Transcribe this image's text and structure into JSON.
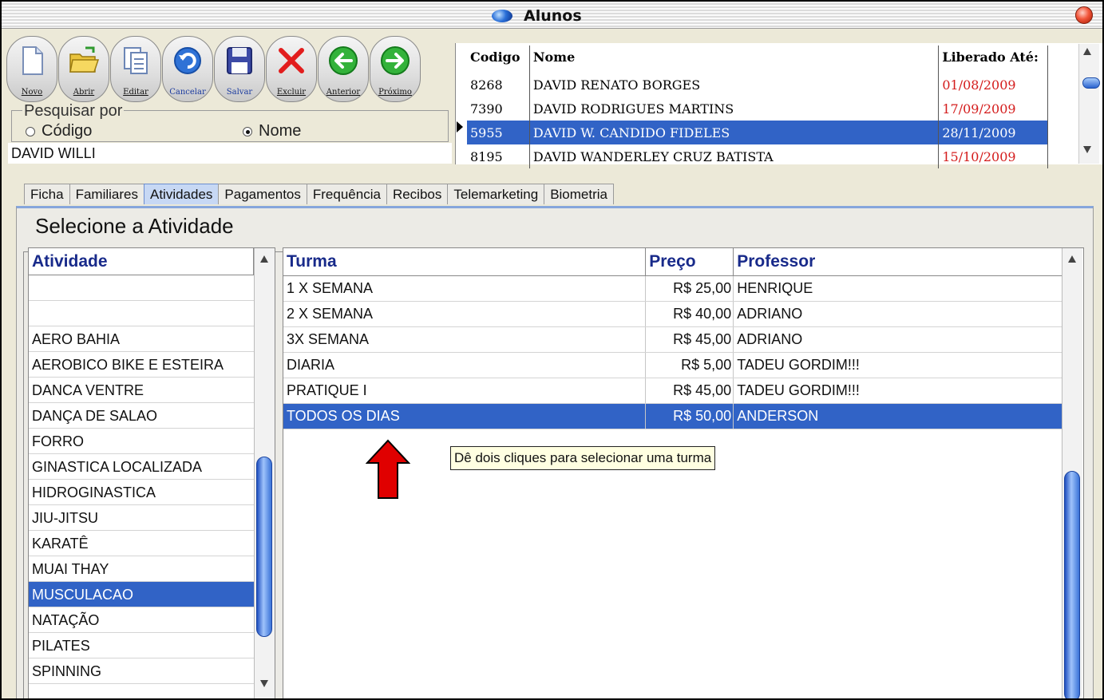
{
  "window": {
    "title": "Alunos"
  },
  "toolbar": {
    "buttons": [
      {
        "label": "Novo",
        "icon": "new-document-icon"
      },
      {
        "label": "Abrir",
        "icon": "open-folder-icon"
      },
      {
        "label": "Editar",
        "icon": "edit-document-icon"
      },
      {
        "label": "Cancelar",
        "icon": "cancel-undo-icon"
      },
      {
        "label": "Salvar",
        "icon": "save-disk-icon"
      },
      {
        "label": "Excluir",
        "icon": "delete-x-icon"
      },
      {
        "label": "Anterior",
        "icon": "previous-arrow-icon"
      },
      {
        "label": "Próximo",
        "icon": "next-arrow-icon"
      }
    ]
  },
  "search": {
    "legend": "Pesquisar por",
    "option_code": "Código",
    "option_name": "Nome",
    "selected": "Nome",
    "value": "DAVID WILLI"
  },
  "students": {
    "columns": [
      "Codigo",
      "Nome",
      "Liberado Até:"
    ],
    "rows": [
      {
        "codigo": "8268",
        "nome": "DAVID RENATO BORGES",
        "liberado": "01/08/2009"
      },
      {
        "codigo": "7390",
        "nome": "DAVID RODRIGUES MARTINS",
        "liberado": "17/09/2009"
      },
      {
        "codigo": "5955",
        "nome": "DAVID W. CANDIDO FIDELES",
        "liberado": "28/11/2009"
      },
      {
        "codigo": "8195",
        "nome": "DAVID WANDERLEY CRUZ BATISTA",
        "liberado": "15/10/2009"
      }
    ],
    "selected_index": 2
  },
  "tabs": [
    "Ficha",
    "Familiares",
    "Atividades",
    "Pagamentos",
    "Frequência",
    "Recibos",
    "Telemarketing",
    "Biometria"
  ],
  "active_tab": "Atividades",
  "section_title": "Selecione a Atividade",
  "activities": {
    "header": "Atividade",
    "items": [
      "",
      "",
      "AERO BAHIA",
      "AEROBICO BIKE E ESTEIRA",
      "DANCA VENTRE",
      "DANÇA DE SALAO",
      "FORRO",
      "GINASTICA LOCALIZADA",
      "HIDROGINASTICA",
      "JIU-JITSU",
      "KARATÊ",
      "MUAI THAY",
      "MUSCULACAO",
      "NATAÇÃO",
      "PILATES",
      "SPINNING"
    ],
    "selected": "MUSCULACAO"
  },
  "turmas": {
    "columns": [
      "Turma",
      "Preço",
      "Professor"
    ],
    "rows": [
      {
        "turma": "1 X SEMANA",
        "preco": "R$ 25,00",
        "professor": "HENRIQUE"
      },
      {
        "turma": "2 X SEMANA",
        "preco": "R$ 40,00",
        "professor": "ADRIANO"
      },
      {
        "turma": "3X SEMANA",
        "preco": "R$ 45,00",
        "professor": "ADRIANO"
      },
      {
        "turma": "DIARIA",
        "preco": "R$ 5,00",
        "professor": "TADEU  GORDIM!!!"
      },
      {
        "turma": "PRATIQUE I",
        "preco": "R$ 45,00",
        "professor": "TADEU  GORDIM!!!"
      },
      {
        "turma": "TODOS OS DIAS",
        "preco": "R$ 50,00",
        "professor": "ANDERSON"
      }
    ],
    "selected_index": 5
  },
  "tooltip": "Dê dois cliques para selecionar uma turma",
  "colors": {
    "selection": "#3163c6",
    "date_red": "#d41c1c",
    "header_blue": "#182a8a",
    "arrow_red": "#e00000"
  }
}
